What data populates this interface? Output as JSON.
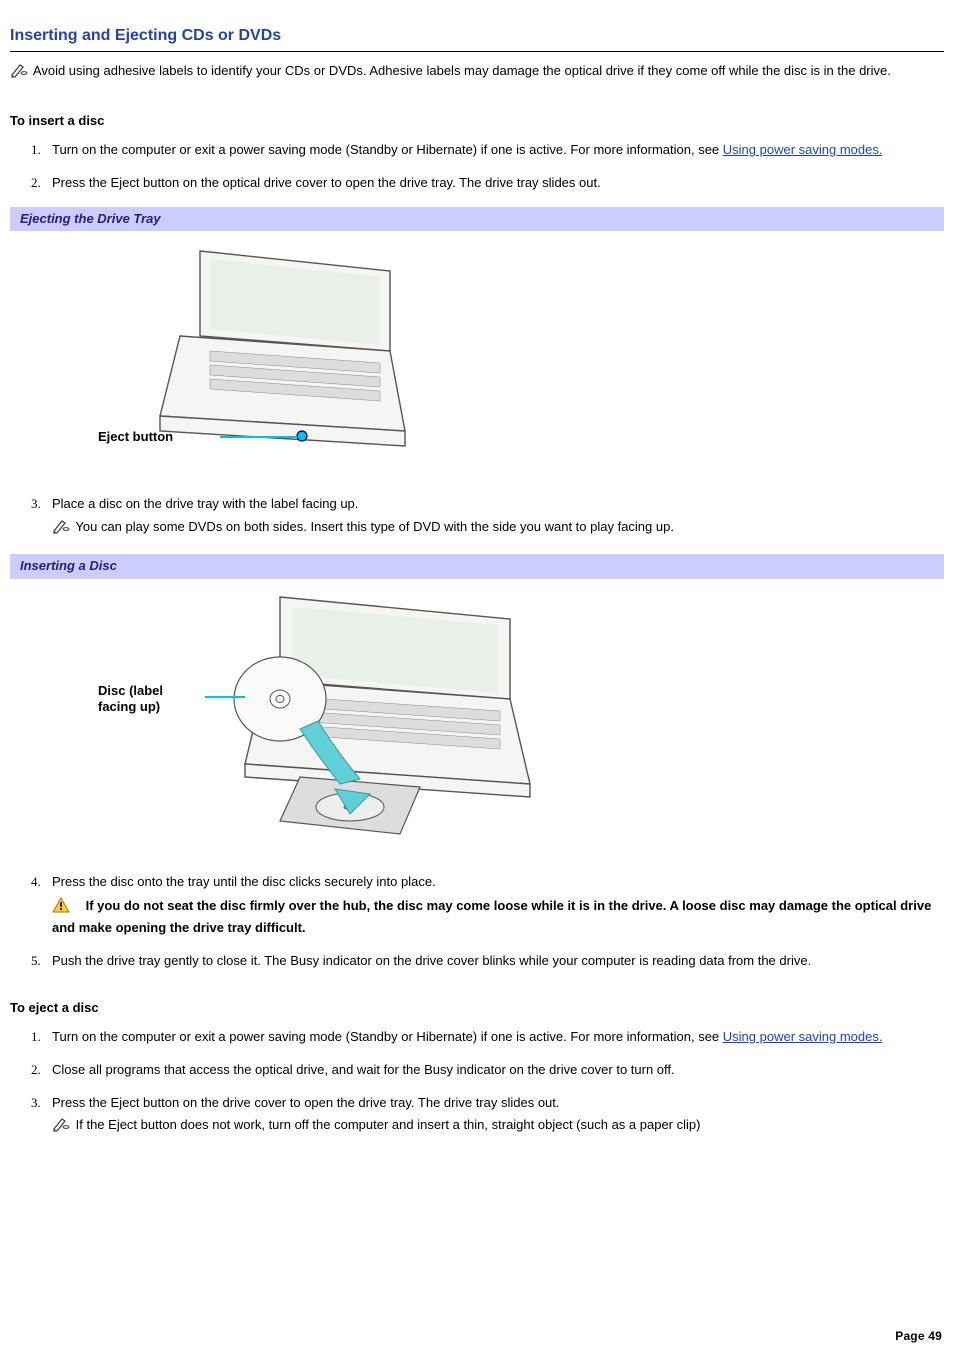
{
  "title": "Inserting and Ejecting CDs or DVDs",
  "intro_note": "Avoid using adhesive labels to identify your CDs or DVDs. Adhesive labels may damage the optical drive if they come off while the disc is in the drive.",
  "insert": {
    "heading": "To insert a disc",
    "step1_a": "Turn on the computer or exit a power saving mode (Standby or Hibernate) if one is active. For more information, see ",
    "step1_link": "Using power saving modes.",
    "step2": "Press the Eject button on the optical drive cover to open the drive tray. The drive tray slides out.",
    "caption1": "Ejecting the Drive Tray",
    "fig1_label": "Eject button",
    "step3": "Place a disc on the drive tray with the label facing up.",
    "step3_note": "You can play some DVDs on both sides. Insert this type of DVD with the side you want to play facing up.",
    "caption2": "Inserting a Disc",
    "fig2_label_a": "Disc (label",
    "fig2_label_b": "facing up)",
    "step4": "Press the disc onto the tray until the disc clicks securely into place.",
    "step4_warn": "If you do not seat the disc firmly over the hub, the disc may come loose while it is in the drive. A loose disc may damage the optical drive and make opening the drive tray difficult.",
    "step5": "Push the drive tray gently to close it. The Busy indicator on the drive cover blinks while your computer is reading data from the drive."
  },
  "eject": {
    "heading": "To eject a disc",
    "step1_a": "Turn on the computer or exit a power saving mode (Standby or Hibernate) if one is active. For more information, see ",
    "step1_link": "Using power saving modes.",
    "step2": "Close all programs that access the optical drive, and wait for the Busy indicator on the drive cover to turn off.",
    "step3": "Press the Eject button on the drive cover to open the drive tray. The drive tray slides out.",
    "step3_note": "If the Eject button does not work, turn off the computer and insert a thin, straight object (such as a paper clip)"
  },
  "page_number": "Page 49"
}
